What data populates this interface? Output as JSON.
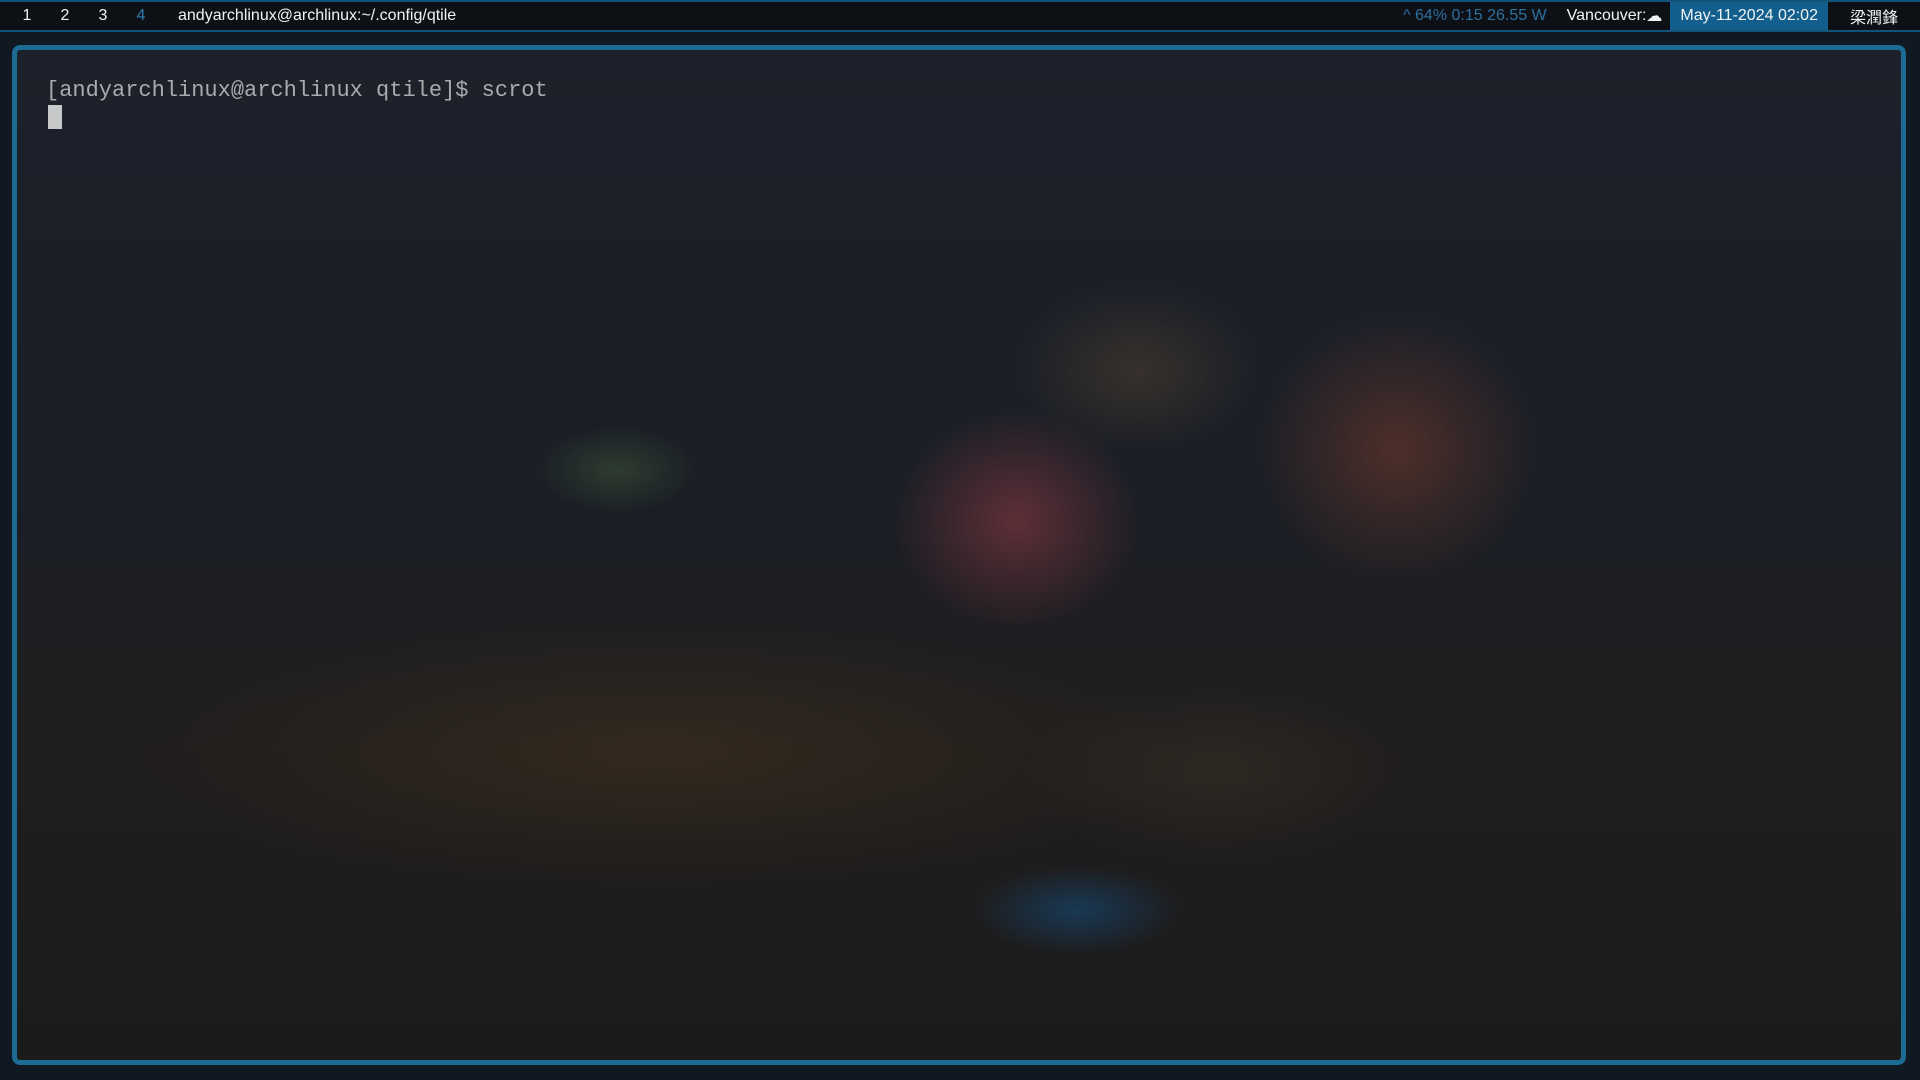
{
  "bar": {
    "groups": [
      {
        "label": "1",
        "active": false
      },
      {
        "label": "2",
        "active": false
      },
      {
        "label": "3",
        "active": false
      },
      {
        "label": "4",
        "active": true
      }
    ],
    "window_name": "andyarchlinux@archlinux:~/.config/qtile",
    "battery": "^ 64% 0:15 26.55 W",
    "weather": {
      "city": "Vancouver:",
      "icon": "cloud-icon",
      "glyph": "☁"
    },
    "clock": "May-11-2024 02:02",
    "user": "梁潤鋒",
    "colors": {
      "accent": "#125f8d",
      "active_group": "#2f7cb0",
      "border": "#1c6b93"
    }
  },
  "terminal": {
    "prompt": "[andyarchlinux@archlinux qtile]$ ",
    "command": "scrot"
  }
}
